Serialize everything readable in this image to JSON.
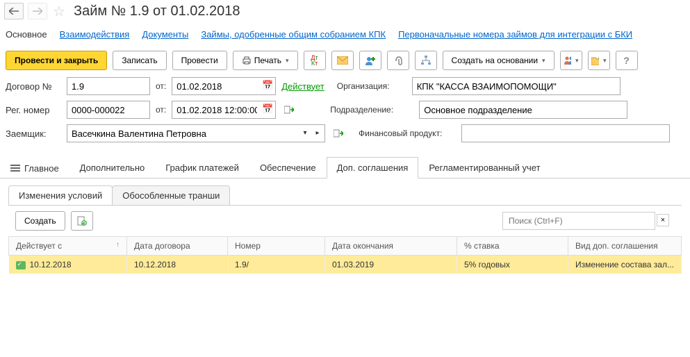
{
  "title": "Займ № 1.9 от 01.02.2018",
  "nav": {
    "main": "Основное",
    "interactions": "Взаимодействия",
    "documents": "Документы",
    "approved": "Займы, одобренные общим собранием КПК",
    "initial_numbers": "Первоначальные номера займов для интеграции с БКИ"
  },
  "toolbar": {
    "post_close": "Провести и закрыть",
    "save": "Записать",
    "post": "Провести",
    "print": "Печать",
    "create_based": "Создать на основании"
  },
  "form": {
    "contract_label": "Договор №",
    "contract_no": "1.9",
    "from_label": "от:",
    "contract_date": "01.02.2018",
    "status": "Действует",
    "org_label": "Организация:",
    "org_value": "КПК \"КАССА ВЗАИМОПОМОЩИ\"",
    "reg_label": "Рег. номер",
    "reg_no": "0000-000022",
    "reg_date": "01.02.2018 12:00:00",
    "dept_label": "Подразделение:",
    "dept_value": "Основное подразделение",
    "borrower_label": "Заемщик:",
    "borrower_value": "Васечкина Валентина Петровна",
    "product_label": "Финансовый продукт:",
    "product_value": ""
  },
  "tabs": {
    "main": "Главное",
    "additional": "Дополнительно",
    "schedule": "График платежей",
    "collateral": "Обеспечение",
    "addendums": "Доп. соглашения",
    "regulated": "Регламентированный учет"
  },
  "subtabs": {
    "changes": "Изменения условий",
    "tranches": "Обособленные транши"
  },
  "subtoolbar": {
    "create": "Создать",
    "search_placeholder": "Поиск (Ctrl+F)"
  },
  "grid": {
    "headers": {
      "effective": "Действует с",
      "contract_date": "Дата договора",
      "number": "Номер",
      "end_date": "Дата окончания",
      "rate": "% ставка",
      "type": "Вид доп. соглашения"
    },
    "row": {
      "effective": "10.12.2018",
      "contract_date": "10.12.2018",
      "number": "1.9/",
      "end_date": "01.03.2019",
      "rate": "5% годовых",
      "type": "Изменение состава зал..."
    }
  }
}
